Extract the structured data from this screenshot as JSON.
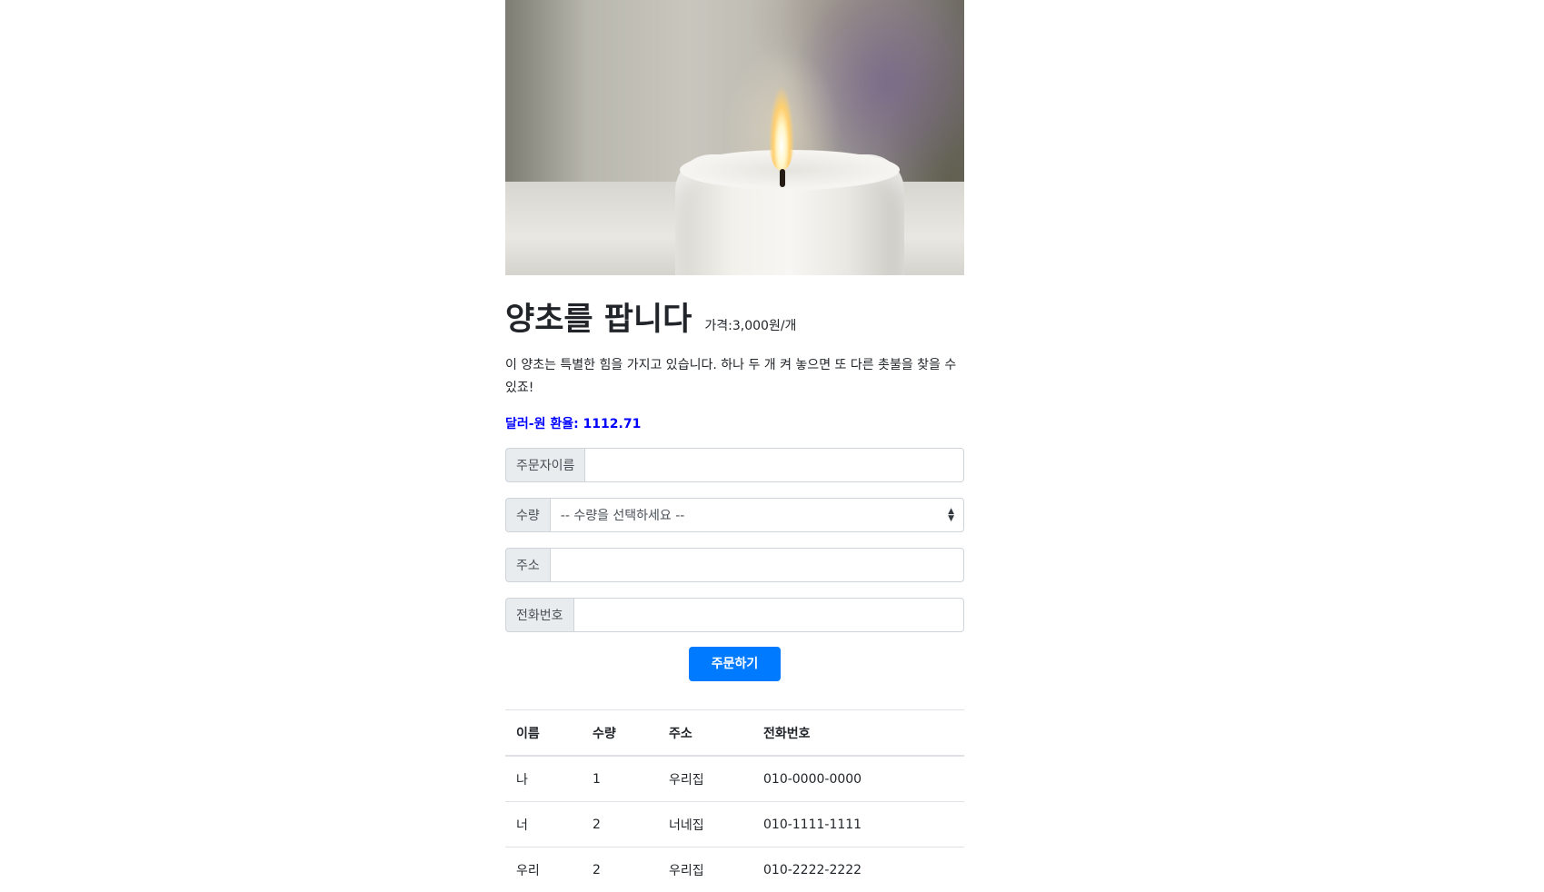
{
  "product": {
    "image_alt": "candle",
    "title": "양초를 팝니다",
    "price": "가격:3,000원/개",
    "description": "이 양초는 특별한 힘을 가지고 있습니다. 하나 두 개 켜 놓으면 또 다른 촛불을 찾을 수 있죠!",
    "exchange_rate": "달러-원 환율: 1112.71"
  },
  "form": {
    "name_label": "주문자이름",
    "name_value": "",
    "quantity_label": "수량",
    "quantity_selected": "-- 수량을 선택하세요 --",
    "address_label": "주소",
    "address_value": "",
    "phone_label": "전화번호",
    "phone_value": "",
    "submit_label": "주문하기"
  },
  "orders": {
    "headers": [
      "이름",
      "수량",
      "주소",
      "전화번호"
    ],
    "rows": [
      [
        "나",
        "1",
        "우리집",
        "010-0000-0000"
      ],
      [
        "너",
        "2",
        "너네집",
        "010-1111-1111"
      ],
      [
        "우리",
        "2",
        "우리집",
        "010-2222-2222"
      ]
    ]
  },
  "colors": {
    "accent": "#007bff",
    "rate_text": "#0000ff",
    "addon_bg": "#e9ecef"
  }
}
